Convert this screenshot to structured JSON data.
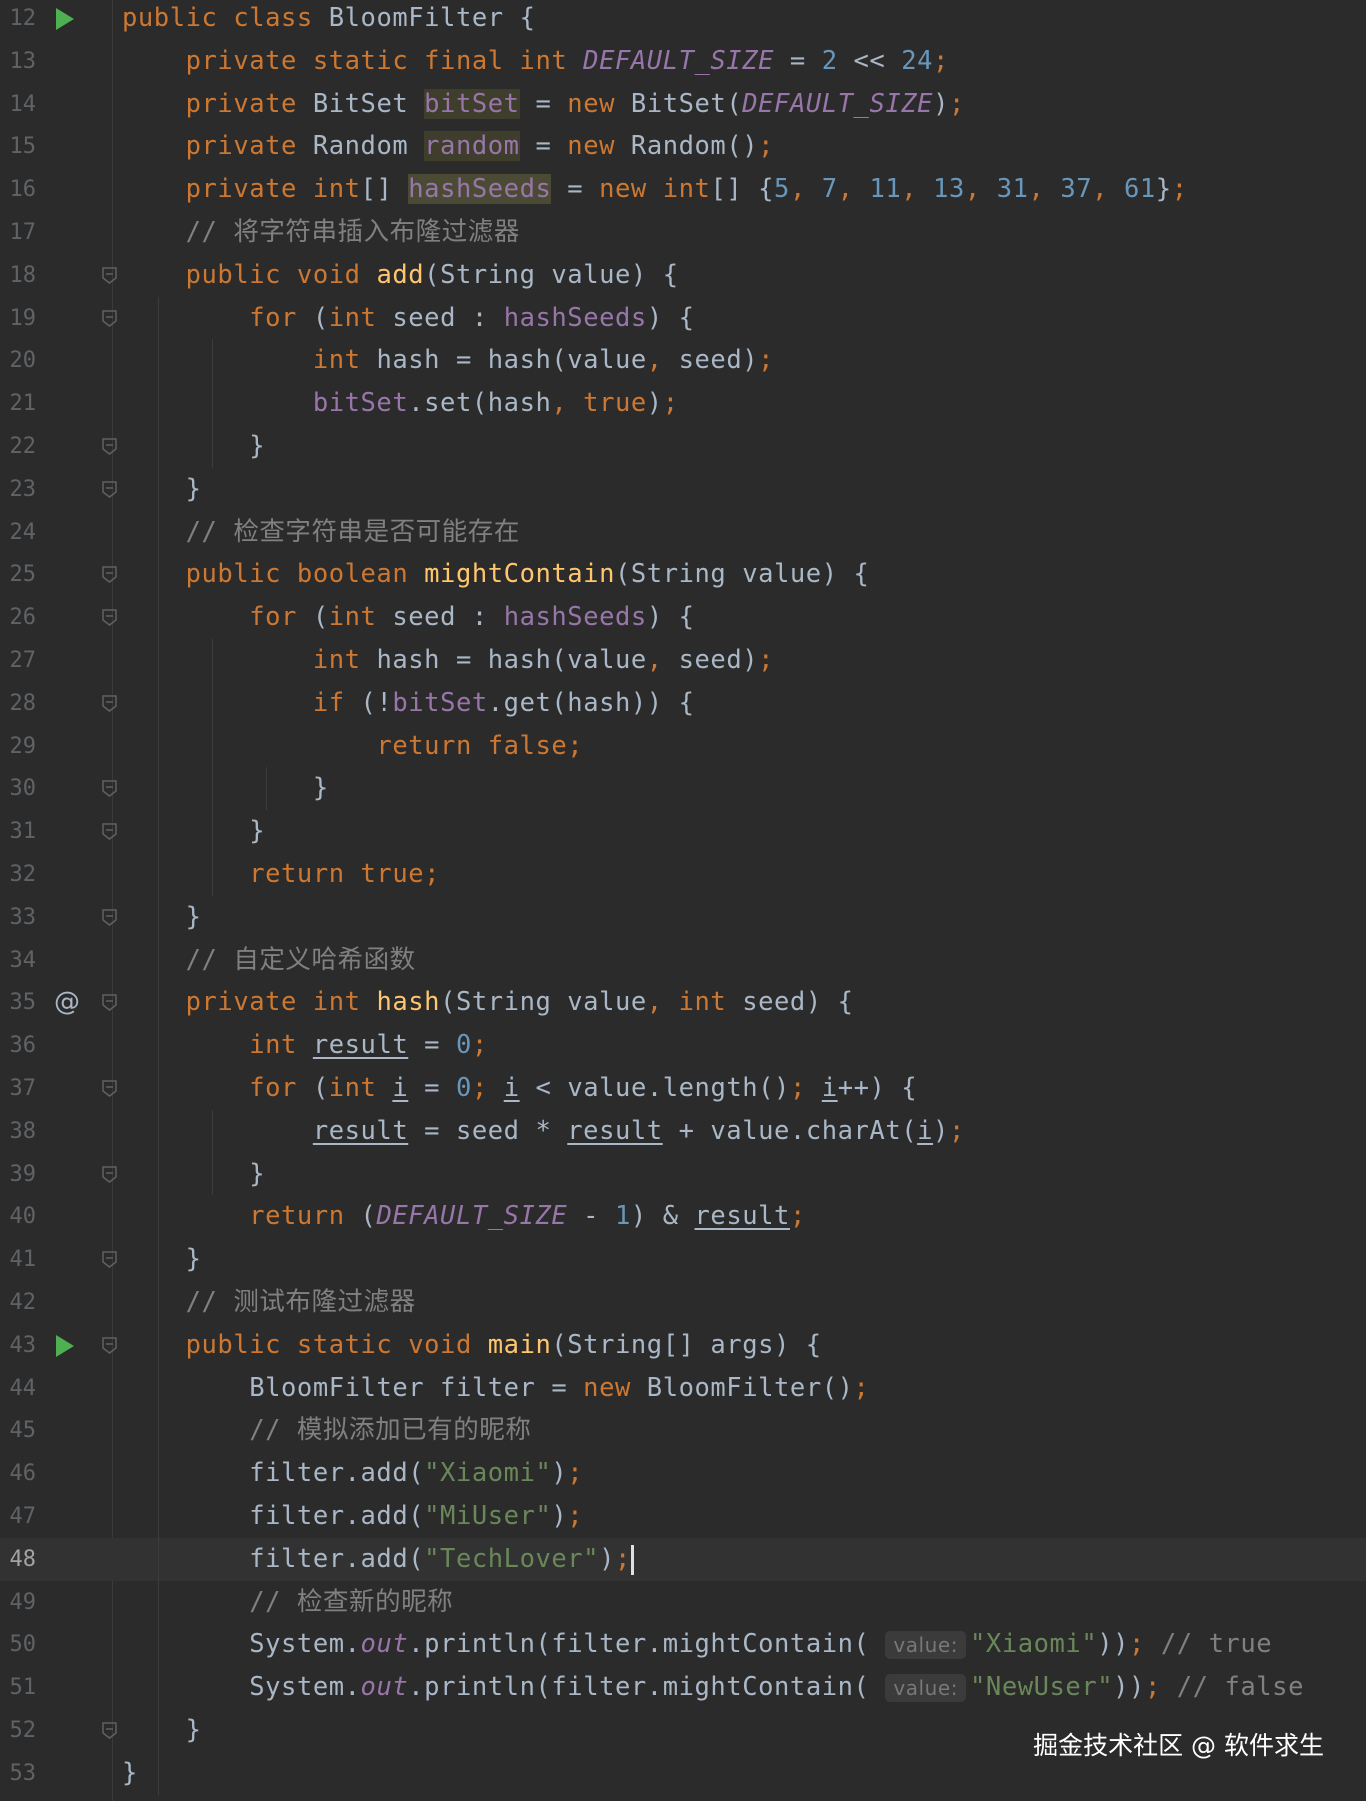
{
  "editor": {
    "lines": [
      {
        "num": "12",
        "gutter": "run",
        "tokens": [
          [
            "kw",
            "public"
          ],
          [
            "d",
            " "
          ],
          [
            "kw",
            "class"
          ],
          [
            "d",
            " BloomFilter {"
          ]
        ]
      },
      {
        "num": "13",
        "tokens": [
          [
            "d",
            "    "
          ],
          [
            "kw",
            "private static final int"
          ],
          [
            "d",
            " "
          ],
          [
            "const",
            "DEFAULT_SIZE"
          ],
          [
            "d",
            " = "
          ],
          [
            "num",
            "2"
          ],
          [
            "d",
            " << "
          ],
          [
            "num",
            "24"
          ],
          [
            "kw",
            ";"
          ]
        ]
      },
      {
        "num": "14",
        "tokens": [
          [
            "d",
            "    "
          ],
          [
            "kw",
            "private"
          ],
          [
            "d",
            " BitSet "
          ],
          [
            "fieldh",
            "bitSet"
          ],
          [
            "d",
            " = "
          ],
          [
            "kw",
            "new"
          ],
          [
            "d",
            " BitSet("
          ],
          [
            "const",
            "DEFAULT_SIZE"
          ],
          [
            "d",
            ")"
          ],
          [
            "kw",
            ";"
          ]
        ]
      },
      {
        "num": "15",
        "tokens": [
          [
            "d",
            "    "
          ],
          [
            "kw",
            "private"
          ],
          [
            "d",
            " Random "
          ],
          [
            "fieldh",
            "random"
          ],
          [
            "d",
            " = "
          ],
          [
            "kw",
            "new"
          ],
          [
            "d",
            " Random()"
          ],
          [
            "kw",
            ";"
          ]
        ]
      },
      {
        "num": "16",
        "tokens": [
          [
            "d",
            "    "
          ],
          [
            "kw",
            "private int"
          ],
          [
            "d",
            "[] "
          ],
          [
            "fieldh2",
            "hashSeeds"
          ],
          [
            "d",
            " = "
          ],
          [
            "kw",
            "new int"
          ],
          [
            "d",
            "[] {"
          ],
          [
            "num",
            "5"
          ],
          [
            "kw",
            ", "
          ],
          [
            "num",
            "7"
          ],
          [
            "kw",
            ", "
          ],
          [
            "num",
            "11"
          ],
          [
            "kw",
            ", "
          ],
          [
            "num",
            "13"
          ],
          [
            "kw",
            ", "
          ],
          [
            "num",
            "31"
          ],
          [
            "kw",
            ", "
          ],
          [
            "num",
            "37"
          ],
          [
            "kw",
            ", "
          ],
          [
            "num",
            "61"
          ],
          [
            "d",
            "}"
          ],
          [
            "kw",
            ";"
          ]
        ]
      },
      {
        "num": "17",
        "tokens": [
          [
            "d",
            "    "
          ],
          [
            "comment",
            "// 将字符串插入布隆过滤器"
          ]
        ]
      },
      {
        "num": "18",
        "gutter": "fold",
        "tokens": [
          [
            "d",
            "    "
          ],
          [
            "kw",
            "public void"
          ],
          [
            "d",
            " "
          ],
          [
            "method",
            "add"
          ],
          [
            "d",
            "(String value) {"
          ]
        ]
      },
      {
        "num": "19",
        "gutter": "fold",
        "tokens": [
          [
            "d",
            "        "
          ],
          [
            "kw",
            "for"
          ],
          [
            "d",
            " ("
          ],
          [
            "kw",
            "int"
          ],
          [
            "d",
            " seed : "
          ],
          [
            "field",
            "hashSeeds"
          ],
          [
            "d",
            ") {"
          ]
        ]
      },
      {
        "num": "20",
        "tokens": [
          [
            "d",
            "            "
          ],
          [
            "kw",
            "int"
          ],
          [
            "d",
            " hash = hash(value"
          ],
          [
            "kw",
            ", "
          ],
          [
            "d",
            "seed)"
          ],
          [
            "kw",
            ";"
          ]
        ]
      },
      {
        "num": "21",
        "tokens": [
          [
            "d",
            "            "
          ],
          [
            "field",
            "bitSet"
          ],
          [
            "d",
            ".set(hash"
          ],
          [
            "kw",
            ", true"
          ],
          [
            "d",
            ")"
          ],
          [
            "kw",
            ";"
          ]
        ]
      },
      {
        "num": "22",
        "gutter": "fold",
        "tokens": [
          [
            "d",
            "        }"
          ]
        ]
      },
      {
        "num": "23",
        "gutter": "fold",
        "tokens": [
          [
            "d",
            "    }"
          ]
        ]
      },
      {
        "num": "24",
        "tokens": [
          [
            "d",
            "    "
          ],
          [
            "comment",
            "// 检查字符串是否可能存在"
          ]
        ]
      },
      {
        "num": "25",
        "gutter": "fold",
        "tokens": [
          [
            "d",
            "    "
          ],
          [
            "kw",
            "public boolean"
          ],
          [
            "d",
            " "
          ],
          [
            "method",
            "mightContain"
          ],
          [
            "d",
            "(String value) {"
          ]
        ]
      },
      {
        "num": "26",
        "gutter": "fold",
        "tokens": [
          [
            "d",
            "        "
          ],
          [
            "kw",
            "for"
          ],
          [
            "d",
            " ("
          ],
          [
            "kw",
            "int"
          ],
          [
            "d",
            " seed : "
          ],
          [
            "field",
            "hashSeeds"
          ],
          [
            "d",
            ") {"
          ]
        ]
      },
      {
        "num": "27",
        "tokens": [
          [
            "d",
            "            "
          ],
          [
            "kw",
            "int"
          ],
          [
            "d",
            " hash = hash(value"
          ],
          [
            "kw",
            ", "
          ],
          [
            "d",
            "seed)"
          ],
          [
            "kw",
            ";"
          ]
        ]
      },
      {
        "num": "28",
        "gutter": "fold",
        "tokens": [
          [
            "d",
            "            "
          ],
          [
            "kw",
            "if"
          ],
          [
            "d",
            " (!"
          ],
          [
            "field",
            "bitSet"
          ],
          [
            "d",
            ".get(hash)) {"
          ]
        ]
      },
      {
        "num": "29",
        "tokens": [
          [
            "d",
            "                "
          ],
          [
            "kw",
            "return false;"
          ]
        ]
      },
      {
        "num": "30",
        "gutter": "fold",
        "tokens": [
          [
            "d",
            "            }"
          ]
        ]
      },
      {
        "num": "31",
        "gutter": "fold",
        "tokens": [
          [
            "d",
            "        }"
          ]
        ]
      },
      {
        "num": "32",
        "tokens": [
          [
            "d",
            "        "
          ],
          [
            "kw",
            "return true;"
          ]
        ]
      },
      {
        "num": "33",
        "gutter": "fold",
        "tokens": [
          [
            "d",
            "    }"
          ]
        ]
      },
      {
        "num": "34",
        "tokens": [
          [
            "d",
            "    "
          ],
          [
            "comment",
            "// 自定义哈希函数"
          ]
        ]
      },
      {
        "num": "35",
        "gutter": "at",
        "tokens": [
          [
            "d",
            "    "
          ],
          [
            "kw",
            "private int"
          ],
          [
            "d",
            " "
          ],
          [
            "method",
            "hash"
          ],
          [
            "d",
            "(String value"
          ],
          [
            "kw",
            ", int"
          ],
          [
            "d",
            " seed) {"
          ]
        ]
      },
      {
        "num": "36",
        "tokens": [
          [
            "d",
            "        "
          ],
          [
            "kw",
            "int"
          ],
          [
            "d",
            " "
          ],
          [
            "var",
            "result"
          ],
          [
            "d",
            " = "
          ],
          [
            "num",
            "0"
          ],
          [
            "kw",
            ";"
          ]
        ]
      },
      {
        "num": "37",
        "gutter": "fold",
        "tokens": [
          [
            "d",
            "        "
          ],
          [
            "kw",
            "for"
          ],
          [
            "d",
            " ("
          ],
          [
            "kw",
            "int"
          ],
          [
            "d",
            " "
          ],
          [
            "var",
            "i"
          ],
          [
            "d",
            " = "
          ],
          [
            "num",
            "0"
          ],
          [
            "kw",
            "; "
          ],
          [
            "var",
            "i"
          ],
          [
            "d",
            " < value.length()"
          ],
          [
            "kw",
            "; "
          ],
          [
            "var",
            "i"
          ],
          [
            "d",
            "++) {"
          ]
        ]
      },
      {
        "num": "38",
        "tokens": [
          [
            "d",
            "            "
          ],
          [
            "var",
            "result"
          ],
          [
            "d",
            " = seed * "
          ],
          [
            "var",
            "result"
          ],
          [
            "d",
            " + value.charAt("
          ],
          [
            "var",
            "i"
          ],
          [
            "d",
            ")"
          ],
          [
            "kw",
            ";"
          ]
        ]
      },
      {
        "num": "39",
        "gutter": "fold",
        "tokens": [
          [
            "d",
            "        }"
          ]
        ]
      },
      {
        "num": "40",
        "tokens": [
          [
            "d",
            "        "
          ],
          [
            "kw",
            "return"
          ],
          [
            "d",
            " ("
          ],
          [
            "const",
            "DEFAULT_SIZE"
          ],
          [
            "d",
            " - "
          ],
          [
            "num",
            "1"
          ],
          [
            "d",
            ") & "
          ],
          [
            "var",
            "result"
          ],
          [
            "kw",
            ";"
          ]
        ]
      },
      {
        "num": "41",
        "gutter": "fold",
        "tokens": [
          [
            "d",
            "    }"
          ]
        ]
      },
      {
        "num": "42",
        "tokens": [
          [
            "d",
            "    "
          ],
          [
            "comment",
            "// 测试布隆过滤器"
          ]
        ]
      },
      {
        "num": "43",
        "gutter": "runfold",
        "tokens": [
          [
            "d",
            "    "
          ],
          [
            "kw",
            "public static void"
          ],
          [
            "d",
            " "
          ],
          [
            "method",
            "main"
          ],
          [
            "d",
            "(String[] args) {"
          ]
        ]
      },
      {
        "num": "44",
        "tokens": [
          [
            "d",
            "        BloomFilter filter = "
          ],
          [
            "kw",
            "new"
          ],
          [
            "d",
            " BloomFilter()"
          ],
          [
            "kw",
            ";"
          ]
        ]
      },
      {
        "num": "45",
        "tokens": [
          [
            "d",
            "        "
          ],
          [
            "comment",
            "// 模拟添加已有的昵称"
          ]
        ]
      },
      {
        "num": "46",
        "tokens": [
          [
            "d",
            "        filter.add("
          ],
          [
            "string",
            "\"Xiaomi\""
          ],
          [
            "d",
            ")"
          ],
          [
            "kw",
            ";"
          ]
        ]
      },
      {
        "num": "47",
        "tokens": [
          [
            "d",
            "        filter.add("
          ],
          [
            "string",
            "\"MiUser\""
          ],
          [
            "d",
            ")"
          ],
          [
            "kw",
            ";"
          ]
        ]
      },
      {
        "num": "48",
        "current": true,
        "tokens": [
          [
            "d",
            "        filter.add("
          ],
          [
            "string",
            "\"TechLover\""
          ],
          [
            "d",
            ")"
          ],
          [
            "kw",
            ";"
          ],
          [
            "caret",
            ""
          ]
        ]
      },
      {
        "num": "49",
        "tokens": [
          [
            "d",
            "        "
          ],
          [
            "comment",
            "// 检查新的昵称"
          ]
        ]
      },
      {
        "num": "50",
        "tokens": [
          [
            "d",
            "        System."
          ],
          [
            "static",
            "out"
          ],
          [
            "d",
            ".println(filter.mightContain( "
          ],
          [
            "hint",
            "value:"
          ],
          [
            "string",
            "\"Xiaomi\""
          ],
          [
            "d",
            "))"
          ],
          [
            "kw",
            "; "
          ],
          [
            "comment",
            "// true"
          ]
        ]
      },
      {
        "num": "51",
        "tokens": [
          [
            "d",
            "        System."
          ],
          [
            "static",
            "out"
          ],
          [
            "d",
            ".println(filter.mightContain( "
          ],
          [
            "hint",
            "value:"
          ],
          [
            "string",
            "\"NewUser\""
          ],
          [
            "d",
            "))"
          ],
          [
            "kw",
            "; "
          ],
          [
            "comment",
            "// false"
          ]
        ]
      },
      {
        "num": "52",
        "gutter": "fold",
        "tokens": [
          [
            "d",
            "    }"
          ]
        ]
      },
      {
        "num": "53",
        "tokens": [
          [
            "d",
            "}"
          ]
        ]
      }
    ]
  },
  "watermark": "掘金技术社区 @ 软件求生",
  "colors": {
    "background": "#2b2b2b",
    "keyword": "#cc7832",
    "number": "#6897bb",
    "field": "#9876aa",
    "method": "#ffc66d",
    "comment": "#808080",
    "string": "#6a8759",
    "text": "#a9b7c6"
  },
  "icons": {
    "run": "run-gutter-icon",
    "fold": "fold-marker-icon",
    "at": "implements-at-icon"
  }
}
